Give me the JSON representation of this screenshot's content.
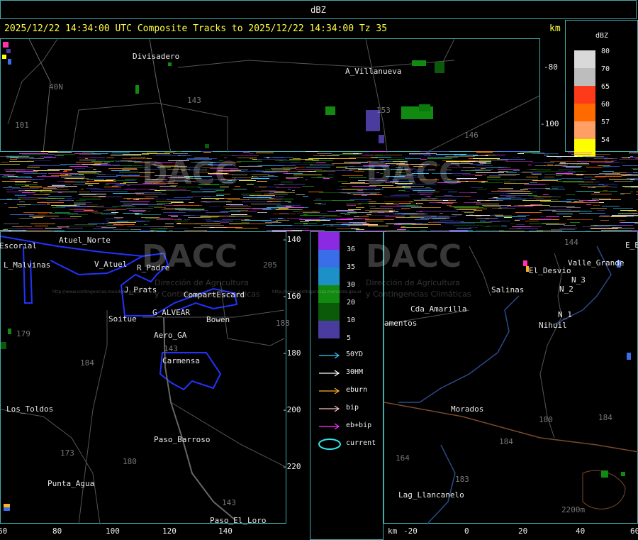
{
  "window": {
    "title": "dBZ"
  },
  "header": {
    "composite_text": "2025/12/22 14:34:00 UTC Composite Tracks to 2025/12/22 14:34:00 Tz 35",
    "unit_label": "km"
  },
  "colorbar": {
    "title": "dBZ",
    "levels": [
      {
        "label": "80",
        "color": "#d9d9d9"
      },
      {
        "label": "70",
        "color": "#bdbdbd"
      },
      {
        "label": "65",
        "color": "#ff3a1a"
      },
      {
        "label": "60",
        "color": "#ff6a00"
      },
      {
        "label": "57",
        "color": "#ff9f66"
      },
      {
        "label": "54",
        "color": "#ffff00"
      }
    ],
    "levels_lower": [
      {
        "label": "36",
        "color": "#8a2be2"
      },
      {
        "label": "35",
        "color": "#3a6ee8"
      },
      {
        "label": "30",
        "color": "#1e90c8"
      },
      {
        "label": "20",
        "color": "#128a12"
      },
      {
        "label": "10",
        "color": "#0a5a0a"
      },
      {
        "label": "5",
        "color": "#4a3c9e"
      }
    ]
  },
  "track_legend": [
    {
      "label": "50YD",
      "color": "#33ccff"
    },
    {
      "label": "30HM",
      "color": "#ffffff"
    },
    {
      "label": "eburn",
      "color": "#ffb020"
    },
    {
      "label": "bip",
      "color": "#ffc0c0"
    },
    {
      "label": "eb+bip",
      "color": "#ff33ff"
    },
    {
      "label": "current",
      "color": "#33e6e6"
    }
  ],
  "places_top": [
    "Divisadero",
    "A_Villanueva",
    "40N",
    "101",
    "143",
    "153",
    "146"
  ],
  "places_left": [
    "Escorial",
    "Atuel_Norte",
    "L_Malvinas",
    "V_Atuel",
    "R_Padre",
    "J_Prats",
    "CompartEscard",
    "G_ALVEAR",
    "Soitue",
    "Bowen",
    "Aero_GA",
    "Carmensa",
    "Los_Toldos",
    "Paso_Barroso",
    "Punta_Agua",
    "Paso_El_Loro"
  ],
  "routes_left": [
    "143",
    "179",
    "184",
    "173",
    "180",
    "143",
    "205",
    "188"
  ],
  "places_right": [
    "El_Desvio",
    "Valle_Grande",
    "N_3",
    "N_2",
    "N_1",
    "Nihuil",
    "Salinas",
    "Cda_Amarilla",
    "amentos",
    "Morados",
    "Lag_Llancanelo",
    "2200m",
    "E_E"
  ],
  "routes_right": [
    "144",
    "184",
    "180",
    "184",
    "164",
    "183"
  ],
  "yaxis_right_top": [
    "-80",
    "-100"
  ],
  "yaxis_left": [
    "-140",
    "-160",
    "-180",
    "-200",
    "-220"
  ],
  "xaxis_left": [
    "60",
    "80",
    "100",
    "120",
    "140"
  ],
  "xaxis_right": {
    "unit": "km",
    "ticks": [
      "-20",
      "0",
      "20",
      "40",
      "60"
    ]
  },
  "watermark": {
    "brand": "DACC",
    "subtitle_1": "Dirección de Agricultura",
    "subtitle_2": "y Contingencias Climáticas",
    "url": "http://www.contingencias.mendoza.gov.ar"
  }
}
